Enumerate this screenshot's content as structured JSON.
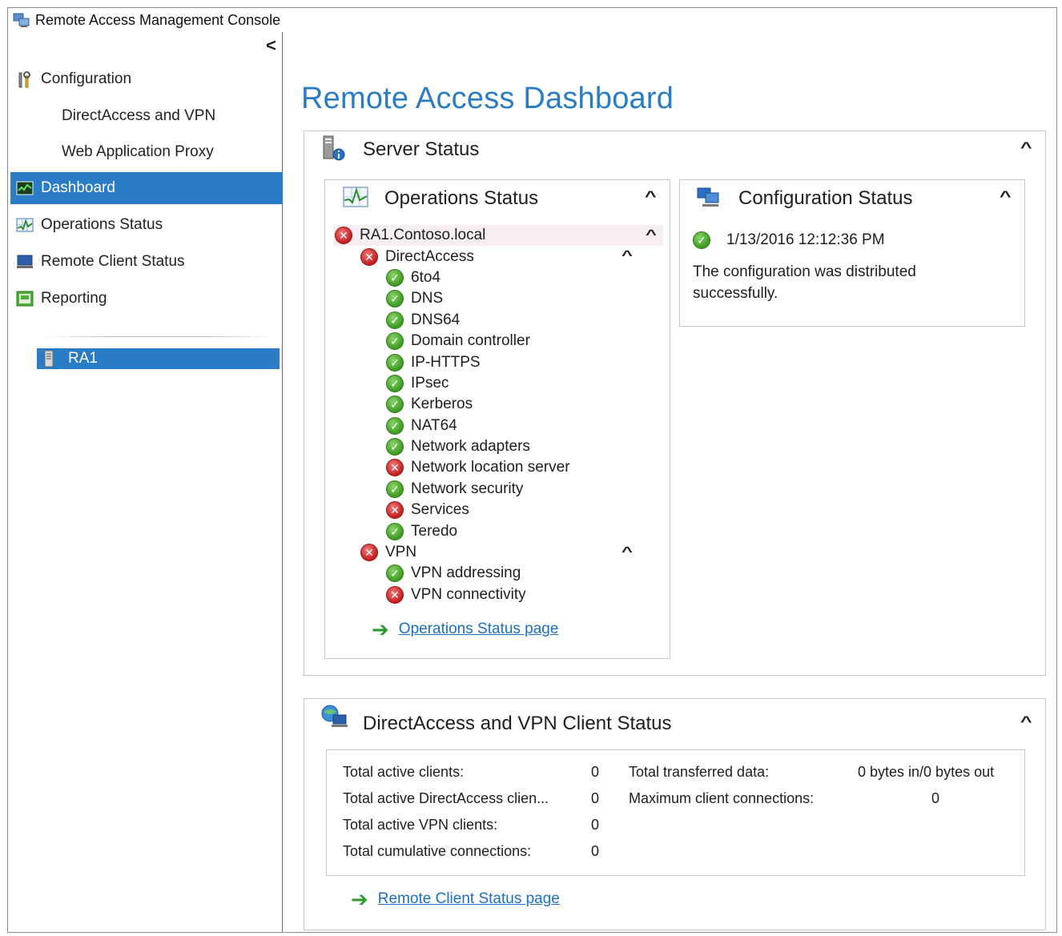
{
  "window": {
    "title": "Remote Access Management Console"
  },
  "sidebar": {
    "collapse_glyph": "<",
    "items": [
      {
        "label": "Configuration",
        "icon": "tools-icon"
      },
      {
        "label": "DirectAccess and VPN"
      },
      {
        "label": "Web Application Proxy"
      },
      {
        "label": "Dashboard",
        "icon": "dashboard-icon",
        "active": true
      },
      {
        "label": "Operations Status",
        "icon": "operations-chart-icon"
      },
      {
        "label": "Remote Client Status",
        "icon": "monitor-icon"
      },
      {
        "label": "Reporting",
        "icon": "report-icon"
      }
    ],
    "server": {
      "label": "RA1",
      "icon": "server-icon"
    }
  },
  "main": {
    "title": "Remote Access Dashboard",
    "server_status": {
      "title": "Server Status",
      "operations": {
        "title": "Operations Status",
        "tree": [
          {
            "label": "RA1.Contoso.local",
            "status": "error",
            "level": 0,
            "expandable": true
          },
          {
            "label": "DirectAccess",
            "status": "error",
            "level": 1,
            "expandable": true
          },
          {
            "label": "6to4",
            "status": "ok",
            "level": 2
          },
          {
            "label": "DNS",
            "status": "ok",
            "level": 2
          },
          {
            "label": "DNS64",
            "status": "ok",
            "level": 2
          },
          {
            "label": "Domain controller",
            "status": "ok",
            "level": 2
          },
          {
            "label": "IP-HTTPS",
            "status": "ok",
            "level": 2
          },
          {
            "label": "IPsec",
            "status": "ok",
            "level": 2
          },
          {
            "label": "Kerberos",
            "status": "ok",
            "level": 2
          },
          {
            "label": "NAT64",
            "status": "ok",
            "level": 2
          },
          {
            "label": "Network adapters",
            "status": "ok",
            "level": 2
          },
          {
            "label": "Network location server",
            "status": "error",
            "level": 2
          },
          {
            "label": "Network security",
            "status": "ok",
            "level": 2
          },
          {
            "label": "Services",
            "status": "error",
            "level": 2
          },
          {
            "label": "Teredo",
            "status": "ok",
            "level": 2
          },
          {
            "label": "VPN",
            "status": "error",
            "level": 1,
            "expandable": true
          },
          {
            "label": "VPN addressing",
            "status": "ok",
            "level": 2
          },
          {
            "label": "VPN connectivity",
            "status": "error",
            "level": 2
          }
        ],
        "link": "Operations Status page"
      },
      "configuration": {
        "title": "Configuration Status",
        "timestamp": "1/13/2016 12:12:36 PM",
        "message": "The configuration was distributed successfully."
      }
    },
    "client_status": {
      "title": "DirectAccess and VPN Client Status",
      "left_stats": [
        {
          "label": "Total active clients:",
          "value": "0"
        },
        {
          "label": "Total active DirectAccess clien...",
          "value": "0"
        },
        {
          "label": "Total active VPN clients:",
          "value": "0"
        },
        {
          "label": "Total cumulative connections:",
          "value": "0"
        }
      ],
      "right_stats": [
        {
          "label": "Total transferred data:",
          "value": "0 bytes in/0 bytes out"
        },
        {
          "label": "Maximum client connections:",
          "value": "0"
        }
      ],
      "link": "Remote Client Status page"
    }
  },
  "colors": {
    "accent": "#2a7cc7",
    "ok": "#3a9a1f",
    "error": "#c31d1d",
    "link": "#1a6fc4"
  }
}
